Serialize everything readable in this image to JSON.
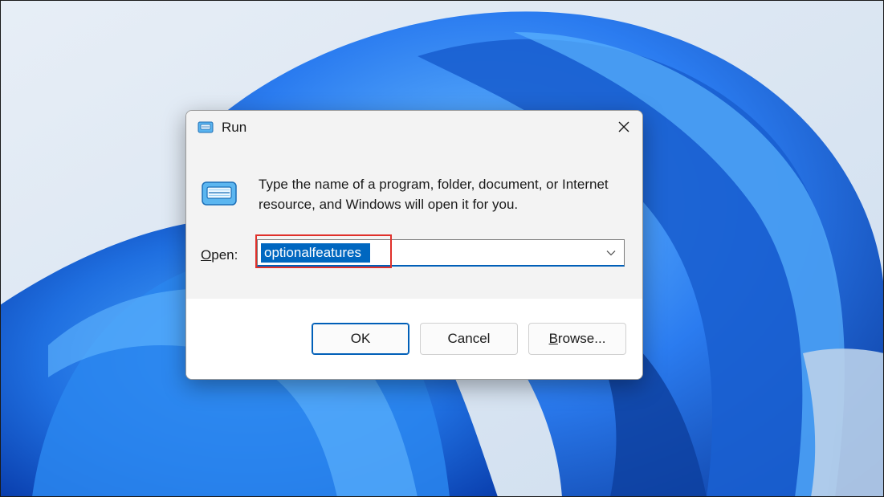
{
  "dialog": {
    "title": "Run",
    "description": "Type the name of a program, folder, document, or Internet resource, and Windows will open it for you.",
    "open_label_accesskey": "O",
    "open_label_rest": "pen:",
    "open_value": "optionalfeatures",
    "buttons": {
      "ok": "OK",
      "cancel": "Cancel",
      "browse_accesskey": "B",
      "browse_rest": "rowse..."
    }
  },
  "colors": {
    "accent": "#0067c0",
    "highlight_annotation": "#e0302a",
    "wallpaper_blue": "#1f6fe0"
  },
  "icons": {
    "title": "run-app-icon",
    "close": "close-icon",
    "dropdown": "chevron-down-icon"
  }
}
